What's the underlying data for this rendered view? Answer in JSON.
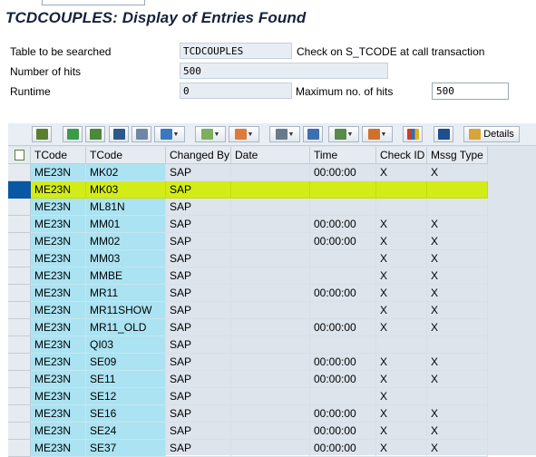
{
  "title": "TCDCOUPLES: Display of Entries Found",
  "fields": {
    "table_label": "Table to be searched",
    "table_value": "TCDCOUPLES",
    "check_label": "Check on S_TCODE at call transaction",
    "hits_label": "Number of hits",
    "hits_value": "500",
    "runtime_label": "Runtime",
    "runtime_value": "0",
    "maxhits_label": "Maximum no. of hits",
    "maxhits_value": "500"
  },
  "toolbar": {
    "details_label": "Details",
    "icons": [
      "details-view-icon",
      "sort-ascending-icon",
      "sort-descending-icon",
      "find-icon",
      "find-next-icon",
      "filter-icon",
      "total-icon",
      "subtotal-icon",
      "print-preview-icon",
      "export-icon",
      "views-icon",
      "layout-icon",
      "chart-icon",
      "info-icon",
      "details-icon"
    ]
  },
  "colors": {
    "key_column": "#abe3f2",
    "selected_row": "#d3ec18",
    "header_bg": "#e6ebf1",
    "title": "#14233a"
  },
  "columns": [
    "TCode",
    "TCode",
    "Changed By",
    "Date",
    "Time",
    "Check ID",
    "Mssg Type"
  ],
  "rows": [
    {
      "c1": "ME23N",
      "c2": "MK02",
      "c3": "SAP",
      "c4": "",
      "c5": "00:00:00",
      "c6": "X",
      "c7": "X"
    },
    {
      "c1": "ME23N",
      "c2": "MK03",
      "c3": "SAP",
      "c4": "",
      "c5": "",
      "c6": "",
      "c7": ""
    },
    {
      "c1": "ME23N",
      "c2": "ML81N",
      "c3": "SAP",
      "c4": "",
      "c5": "",
      "c6": "",
      "c7": ""
    },
    {
      "c1": "ME23N",
      "c2": "MM01",
      "c3": "SAP",
      "c4": "",
      "c5": "00:00:00",
      "c6": "X",
      "c7": "X"
    },
    {
      "c1": "ME23N",
      "c2": "MM02",
      "c3": "SAP",
      "c4": "",
      "c5": "00:00:00",
      "c6": "X",
      "c7": "X"
    },
    {
      "c1": "ME23N",
      "c2": "MM03",
      "c3": "SAP",
      "c4": "",
      "c5": "",
      "c6": "X",
      "c7": "X"
    },
    {
      "c1": "ME23N",
      "c2": "MMBE",
      "c3": "SAP",
      "c4": "",
      "c5": "",
      "c6": "X",
      "c7": "X"
    },
    {
      "c1": "ME23N",
      "c2": "MR11",
      "c3": "SAP",
      "c4": "",
      "c5": "00:00:00",
      "c6": "X",
      "c7": "X"
    },
    {
      "c1": "ME23N",
      "c2": "MR11SHOW",
      "c3": "SAP",
      "c4": "",
      "c5": "",
      "c6": "X",
      "c7": "X"
    },
    {
      "c1": "ME23N",
      "c2": "MR11_OLD",
      "c3": "SAP",
      "c4": "",
      "c5": "00:00:00",
      "c6": "X",
      "c7": "X"
    },
    {
      "c1": "ME23N",
      "c2": "QI03",
      "c3": "SAP",
      "c4": "",
      "c5": "",
      "c6": "",
      "c7": ""
    },
    {
      "c1": "ME23N",
      "c2": "SE09",
      "c3": "SAP",
      "c4": "",
      "c5": "00:00:00",
      "c6": "X",
      "c7": "X"
    },
    {
      "c1": "ME23N",
      "c2": "SE11",
      "c3": "SAP",
      "c4": "",
      "c5": "00:00:00",
      "c6": "X",
      "c7": "X"
    },
    {
      "c1": "ME23N",
      "c2": "SE12",
      "c3": "SAP",
      "c4": "",
      "c5": "",
      "c6": "X",
      "c7": ""
    },
    {
      "c1": "ME23N",
      "c2": "SE16",
      "c3": "SAP",
      "c4": "",
      "c5": "00:00:00",
      "c6": "X",
      "c7": "X"
    },
    {
      "c1": "ME23N",
      "c2": "SE24",
      "c3": "SAP",
      "c4": "",
      "c5": "00:00:00",
      "c6": "X",
      "c7": "X"
    },
    {
      "c1": "ME23N",
      "c2": "SE37",
      "c3": "SAP",
      "c4": "",
      "c5": "00:00:00",
      "c6": "X",
      "c7": "X"
    }
  ],
  "selected_row_index": 1
}
